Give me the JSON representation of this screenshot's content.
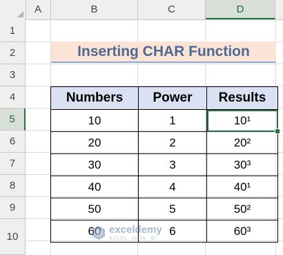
{
  "columns": [
    "A",
    "B",
    "C",
    "D"
  ],
  "rows": [
    "1",
    "2",
    "3",
    "4",
    "5",
    "6",
    "7",
    "8",
    "9",
    "10"
  ],
  "active_cell": {
    "column": "D",
    "row": "5"
  },
  "title": "Inserting CHAR Function",
  "table": {
    "headers": [
      "Numbers",
      "Power",
      "Results"
    ],
    "rows": [
      [
        "10",
        "1",
        "10¹"
      ],
      [
        "20",
        "2",
        "20²"
      ],
      [
        "30",
        "3",
        "30³"
      ],
      [
        "40",
        "4",
        "40¹"
      ],
      [
        "50",
        "5",
        "50²"
      ],
      [
        "60",
        "6",
        "60³"
      ]
    ]
  },
  "watermark": {
    "name": "exceldemy",
    "tagline": "EXCEL · DATA · BI",
    "icon": "exceldemy-logo-icon"
  },
  "colors": {
    "title_fill": "#fbe4d5",
    "title_text": "#4c6a93",
    "header_fill": "#d9e1f2",
    "selection": "#217346"
  }
}
